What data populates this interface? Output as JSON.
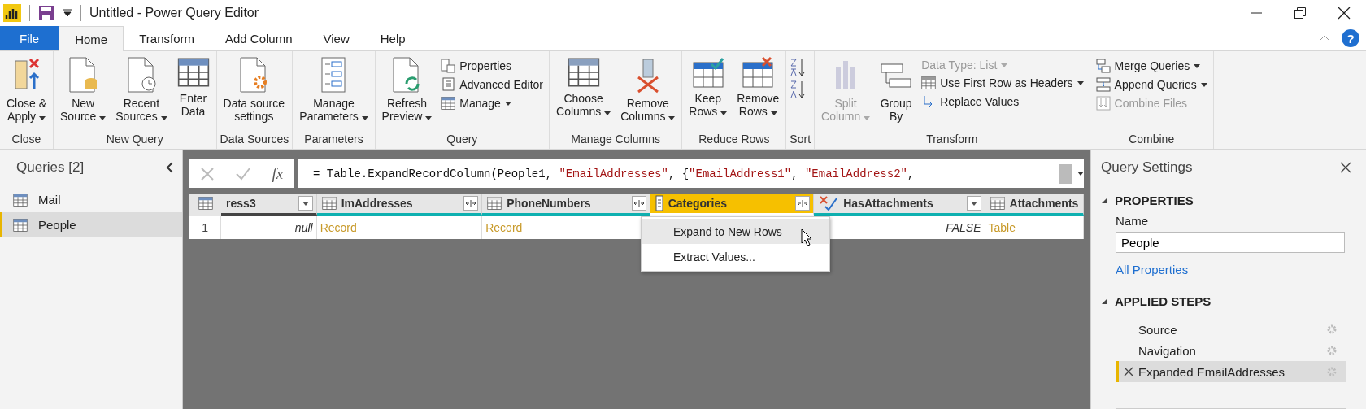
{
  "window": {
    "title": "Untitled - Power Query Editor"
  },
  "tabs": [
    {
      "label": "File",
      "kind": "file",
      "selected": false
    },
    {
      "label": "Home",
      "kind": "tab",
      "selected": true
    },
    {
      "label": "Transform",
      "kind": "tab",
      "selected": false
    },
    {
      "label": "Add Column",
      "kind": "tab",
      "selected": false
    },
    {
      "label": "View",
      "kind": "tab",
      "selected": false
    },
    {
      "label": "Help",
      "kind": "tab",
      "selected": false
    }
  ],
  "help": "?",
  "ribbon": [
    {
      "label": "Close",
      "items": [
        {
          "kind": "large",
          "lines": [
            "Close &",
            "Apply"
          ],
          "dropdown": true,
          "disabled": false
        }
      ]
    },
    {
      "label": "New Query",
      "items": [
        {
          "kind": "large",
          "lines": [
            "New",
            "Source"
          ],
          "dropdown": true,
          "disabled": false
        },
        {
          "kind": "large",
          "lines": [
            "Recent",
            "Sources"
          ],
          "dropdown": true,
          "disabled": false
        },
        {
          "kind": "large",
          "lines": [
            "Enter",
            "Data"
          ],
          "dropdown": false,
          "disabled": false
        }
      ]
    },
    {
      "label": "Data Sources",
      "items": [
        {
          "kind": "large",
          "lines": [
            "Data source",
            "settings"
          ],
          "dropdown": false,
          "disabled": false
        }
      ]
    },
    {
      "label": "Parameters",
      "items": [
        {
          "kind": "large",
          "lines": [
            "Manage",
            "Parameters"
          ],
          "dropdown": true,
          "disabled": false
        }
      ]
    },
    {
      "label": "Query",
      "items": [
        {
          "kind": "large",
          "lines": [
            "Refresh",
            "Preview"
          ],
          "dropdown": true,
          "disabled": false
        },
        {
          "kind": "stack",
          "entries": [
            {
              "label": "Properties",
              "dropdown": false,
              "disabled": false
            },
            {
              "label": "Advanced Editor",
              "dropdown": false,
              "disabled": false
            },
            {
              "label": "Manage",
              "dropdown": true,
              "disabled": false
            }
          ]
        }
      ]
    },
    {
      "label": "Manage Columns",
      "items": [
        {
          "kind": "large",
          "lines": [
            "Choose",
            "Columns"
          ],
          "dropdown": true,
          "disabled": false
        },
        {
          "kind": "large",
          "lines": [
            "Remove",
            "Columns"
          ],
          "dropdown": true,
          "disabled": false
        }
      ]
    },
    {
      "label": "Reduce Rows",
      "items": [
        {
          "kind": "large",
          "lines": [
            "Keep",
            "Rows"
          ],
          "dropdown": true,
          "disabled": false
        },
        {
          "kind": "large",
          "lines": [
            "Remove",
            "Rows"
          ],
          "dropdown": true,
          "disabled": false
        }
      ]
    },
    {
      "label": "Sort",
      "items": [
        {
          "kind": "sort"
        }
      ]
    },
    {
      "label": "Transform",
      "items": [
        {
          "kind": "large",
          "lines": [
            "Split",
            "Column"
          ],
          "dropdown": true,
          "disabled": true
        },
        {
          "kind": "large",
          "lines": [
            "Group",
            "By"
          ],
          "dropdown": false,
          "disabled": false
        },
        {
          "kind": "stack",
          "entries": [
            {
              "label": "Data Type: List",
              "dropdown": true,
              "disabled": true
            },
            {
              "label": "Use First Row as Headers",
              "dropdown": true,
              "disabled": false
            },
            {
              "label": "Replace Values",
              "dropdown": false,
              "disabled": false
            }
          ]
        }
      ]
    },
    {
      "label": "Combine",
      "items": [
        {
          "kind": "stack",
          "entries": [
            {
              "label": "Merge Queries",
              "dropdown": true,
              "disabled": false
            },
            {
              "label": "Append Queries",
              "dropdown": true,
              "disabled": false
            },
            {
              "label": "Combine Files",
              "dropdown": false,
              "disabled": true
            }
          ]
        }
      ]
    }
  ],
  "queries": {
    "title": "Queries [2]",
    "items": [
      {
        "label": "Mail",
        "selected": false
      },
      {
        "label": "People",
        "selected": true
      }
    ]
  },
  "formula": {
    "fx": "fx",
    "tokens": [
      {
        "kind": "code",
        "text": "= Table.ExpandRecordColumn(People1, "
      },
      {
        "kind": "string",
        "text": "\"EmailAddresses\""
      },
      {
        "kind": "code",
        "text": ", {"
      },
      {
        "kind": "string",
        "text": "\"EmailAddress1\""
      },
      {
        "kind": "code",
        "text": ", "
      },
      {
        "kind": "string",
        "text": "\"EmailAddress2\""
      },
      {
        "kind": "code",
        "text": ","
      }
    ]
  },
  "table": {
    "columns": [
      {
        "name": "ress3",
        "selected": false
      },
      {
        "name": "ImAddresses",
        "selected": false
      },
      {
        "name": "PhoneNumbers",
        "selected": false
      },
      {
        "name": "Categories",
        "selected": true
      },
      {
        "name": "HasAttachments",
        "selected": false
      },
      {
        "name": "Attachments",
        "selected": false
      }
    ],
    "rows": [
      {
        "number": "1",
        "cells": [
          {
            "kind": "null",
            "text": "null"
          },
          {
            "kind": "link",
            "text": "Record"
          },
          {
            "kind": "link",
            "text": "Record"
          },
          {
            "kind": "hidden",
            "text": ""
          },
          {
            "kind": "bool",
            "text": "FALSE"
          },
          {
            "kind": "link",
            "text": "Table"
          }
        ]
      }
    ]
  },
  "menu": {
    "items": [
      {
        "label": "Expand to New Rows",
        "selected": true
      },
      {
        "label": "Extract Values...",
        "selected": false
      }
    ]
  },
  "settings": {
    "title": "Query Settings",
    "properties": "PROPERTIES",
    "name_label": "Name",
    "name_value": "People",
    "all_properties": "All Properties",
    "steps_title": "APPLIED STEPS",
    "steps": [
      {
        "label": "Source",
        "selected": false
      },
      {
        "label": "Navigation",
        "selected": false
      },
      {
        "label": "Expanded EmailAddresses",
        "selected": true
      }
    ]
  }
}
